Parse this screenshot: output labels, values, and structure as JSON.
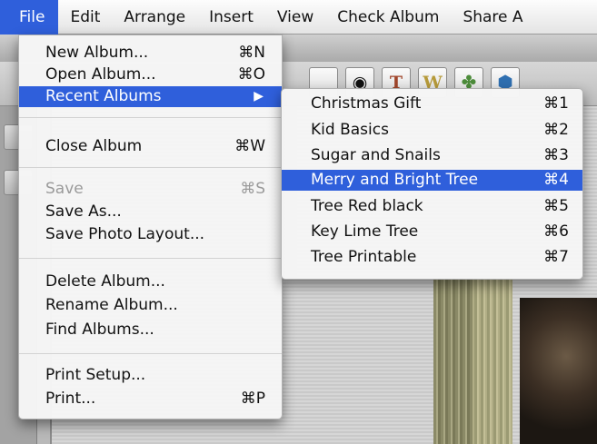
{
  "menubar": {
    "items": [
      "File",
      "Edit",
      "Arrange",
      "Insert",
      "View",
      "Check Album",
      "Share A"
    ]
  },
  "toolbar": {
    "icons": [
      "page-icon",
      "camera-icon",
      "text-t-icon",
      "wordart-w-icon",
      "puzzle-icon",
      "globe-icon"
    ],
    "tool_glyphs": [
      "",
      "◉",
      "T",
      "W",
      "✤",
      "⬢"
    ]
  },
  "file_menu": {
    "new_album": {
      "label": "New Album...",
      "shortcut": "⌘N"
    },
    "open_album": {
      "label": "Open Album...",
      "shortcut": "⌘O"
    },
    "recent_albums": {
      "label": "Recent Albums",
      "arrow": "▶"
    },
    "close_album": {
      "label": "Close Album",
      "shortcut": "⌘W"
    },
    "save": {
      "label": "Save",
      "shortcut": "⌘S"
    },
    "save_as": {
      "label": "Save As..."
    },
    "save_photo_layout": {
      "label": "Save Photo Layout..."
    },
    "delete_album": {
      "label": "Delete Album..."
    },
    "rename_album": {
      "label": "Rename Album..."
    },
    "find_albums": {
      "label": "Find Albums..."
    },
    "print_setup": {
      "label": "Print Setup..."
    },
    "print": {
      "label": "Print...",
      "shortcut": "⌘P"
    }
  },
  "recent_menu": {
    "items": [
      {
        "label": "Christmas Gift",
        "shortcut": "⌘1"
      },
      {
        "label": "Kid Basics",
        "shortcut": "⌘2"
      },
      {
        "label": "Sugar and Snails",
        "shortcut": "⌘3"
      },
      {
        "label": "Merry and Bright Tree",
        "shortcut": "⌘4"
      },
      {
        "label": "Tree Red black",
        "shortcut": "⌘5"
      },
      {
        "label": "Key Lime Tree",
        "shortcut": "⌘6"
      },
      {
        "label": "Tree Printable",
        "shortcut": "⌘7"
      }
    ]
  },
  "colors": {
    "highlight": "#2f5fdb",
    "disabled_text": "#9a9a9a"
  }
}
